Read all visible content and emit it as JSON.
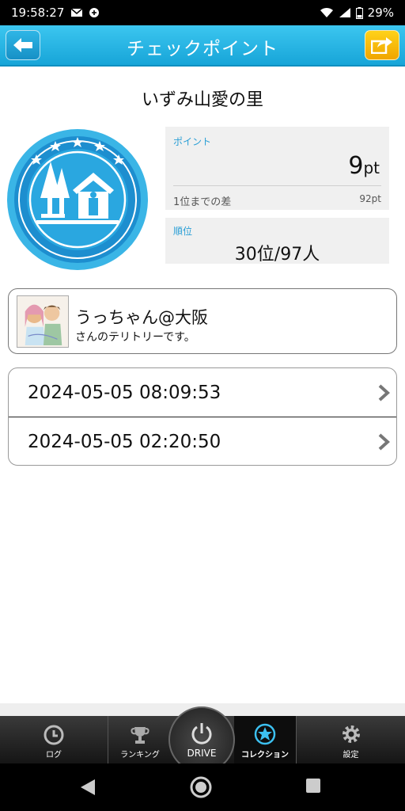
{
  "status_bar": {
    "time": "19:58:27",
    "battery": "29%"
  },
  "header": {
    "title": "チェックポイント",
    "back_icon": "back-arrow-icon",
    "share_icon": "share-icon"
  },
  "place": {
    "name": "いずみ山愛の里"
  },
  "points": {
    "label": "ポイント",
    "value": "9",
    "unit": "pt",
    "gap_label": "1位までの差",
    "gap_value": "92pt"
  },
  "rank": {
    "label": "順位",
    "value": "30位/97人"
  },
  "owner": {
    "name": "うっちゃん@大阪",
    "sub": "さんのテリトリーです。"
  },
  "visits": [
    "2024-05-05 08:09:53",
    "2024-05-05 02:20:50"
  ],
  "tabs": [
    {
      "label": "ログ",
      "icon": "clock-icon"
    },
    {
      "label": "ランキング",
      "icon": "trophy-icon"
    },
    {
      "label": "DRIVE",
      "icon": "power-icon"
    },
    {
      "label": "コレクション",
      "icon": "star-icon",
      "active": true
    },
    {
      "label": "設定",
      "icon": "gear-icon"
    }
  ],
  "colors": {
    "header": "#17a5d8",
    "accent_label": "#2a9fd6",
    "badge": "#3ab5e6",
    "share_button": "#f0a500"
  }
}
